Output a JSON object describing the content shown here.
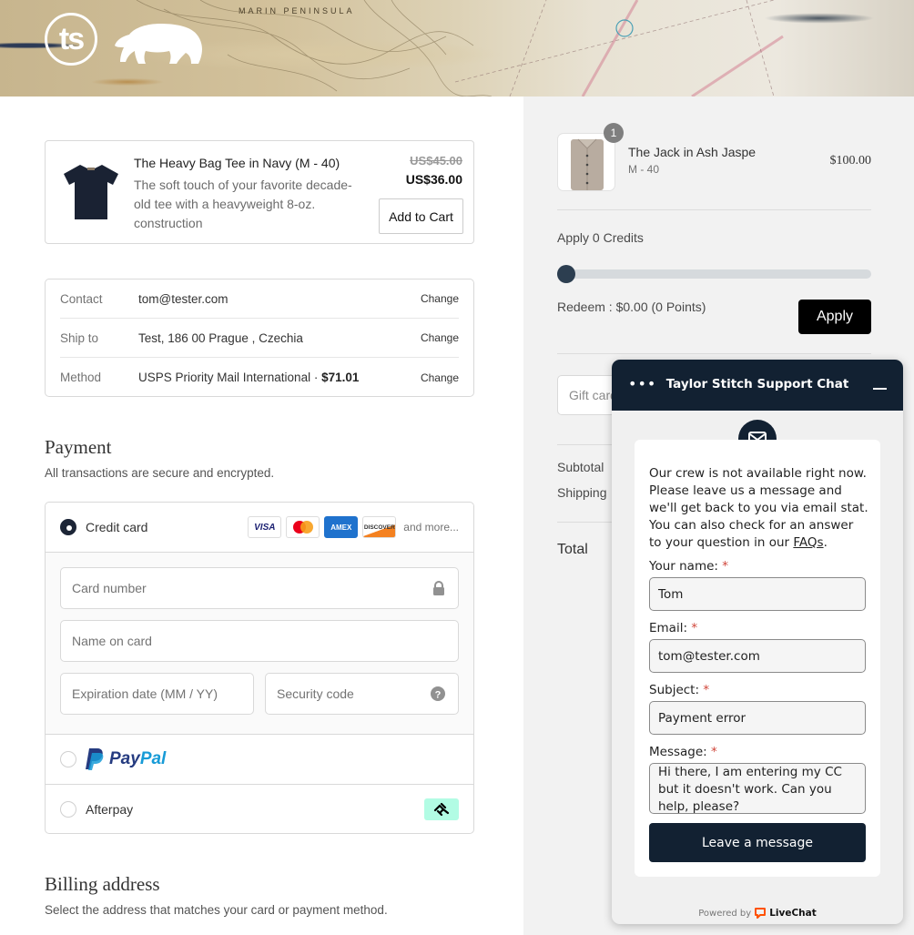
{
  "header": {
    "logo_text": "ts",
    "map_label": "MARIN PENINSULA"
  },
  "upsell": {
    "title": "The Heavy Bag Tee in Navy (M - 40)",
    "description": "The soft touch of your favorite decade-old tee with a heavyweight 8-oz. construction",
    "original_price": "US$45.00",
    "sale_price": "US$36.00",
    "add_button": "Add to Cart"
  },
  "review": {
    "rows": [
      {
        "label": "Contact",
        "value": "tom@tester.com",
        "bold": "",
        "action": "Change"
      },
      {
        "label": "Ship to",
        "value": "Test, 186 00 Prague , Czechia",
        "bold": "",
        "action": "Change"
      },
      {
        "label": "Method",
        "value": "USPS Priority Mail International · ",
        "bold": "$71.01",
        "action": "Change"
      }
    ]
  },
  "payment": {
    "title": "Payment",
    "subtitle": "All transactions are secure and encrypted.",
    "credit_card_label": "Credit card",
    "card_brands": [
      "VISA",
      "Mastercard",
      "AMEX",
      "DISCOVER"
    ],
    "and_more": "and more...",
    "fields": {
      "card_number": "Card number",
      "name_on_card": "Name on card",
      "expiration": "Expiration date (MM / YY)",
      "security_code": "Security code"
    },
    "paypal_label": "PayPal",
    "paypal_pay": "Pay",
    "paypal_pal": "Pal",
    "afterpay_label": "Afterpay",
    "selected": "credit_card"
  },
  "billing": {
    "title": "Billing address",
    "subtitle": "Select the address that matches your card or payment method."
  },
  "summary": {
    "item": {
      "name": "The Jack in Ash Jaspe",
      "variant": "M - 40",
      "price": "$100.00",
      "quantity": "1"
    },
    "credits_label": "Apply 0 Credits",
    "credits_fraction": 0,
    "redeem_text": "Redeem : $0.00 (0 Points)",
    "apply_button": "Apply",
    "gift_card_placeholder": "Gift card",
    "subtotal_label": "Subtotal",
    "shipping_label": "Shipping",
    "total_label": "Total"
  },
  "chat": {
    "title": "Taylor Stitch Support Chat",
    "menu_icon": "•••",
    "message_pre": "Our crew is not available right now. Please leave us a message and we'll get back to you via email stat. You can also check for an answer to your question in our ",
    "faq_link": "FAQs",
    "message_post": ".",
    "name_label": "Your name:",
    "name_value": "Tom",
    "email_label": "Email:",
    "email_value": "tom@tester.com",
    "subject_label": "Subject:",
    "subject_value": "Payment error",
    "message_label": "Message:",
    "message_value": "Hi there, I am entering my CC but it doesn't work. Can you help, please?",
    "required_mark": "*",
    "submit": "Leave a message",
    "powered_by": "Powered by",
    "brand": "LiveChat",
    "brand_color": "#ff5100",
    "header_color": "#122132"
  }
}
